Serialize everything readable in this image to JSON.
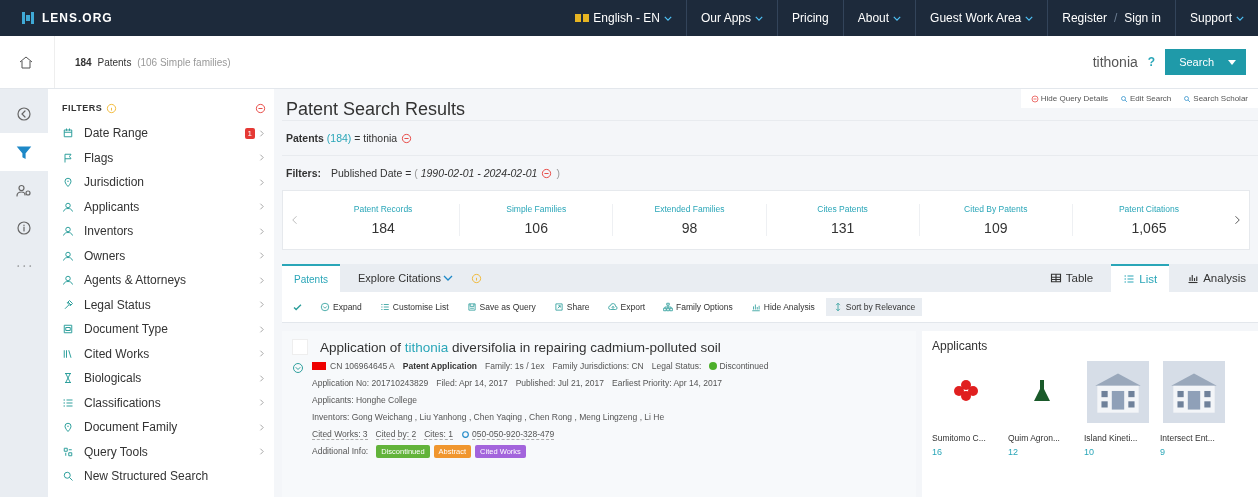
{
  "nav": {
    "logo": "LENS.ORG",
    "language": "English - EN",
    "items": [
      {
        "label": "Our Apps",
        "dropdown": true
      },
      {
        "label": "Pricing",
        "dropdown": false
      },
      {
        "label": "About",
        "dropdown": true
      },
      {
        "label": "Guest Work Area",
        "dropdown": true
      },
      {
        "label": "Register",
        "separator": "/",
        "label2": "Sign in"
      },
      {
        "label": "Support",
        "dropdown": true
      }
    ]
  },
  "search_bar": {
    "count": "184",
    "count_label": "Patents",
    "families": "(106 Simple families)",
    "query": "tithonia",
    "help": "?",
    "button": "Search"
  },
  "rail": [
    {
      "kind": "back",
      "selected": false
    },
    {
      "kind": "filter",
      "selected": true
    },
    {
      "kind": "people",
      "selected": false
    },
    {
      "kind": "info",
      "selected": false
    },
    {
      "kind": "more",
      "selected": false
    }
  ],
  "filters": {
    "title": "FILTERS",
    "items": [
      {
        "label": "Date Range",
        "kind": "calendar",
        "badge": "1",
        "chevron": true
      },
      {
        "label": "Flags",
        "kind": "flag",
        "chevron": true
      },
      {
        "label": "Jurisdiction",
        "kind": "pin",
        "chevron": true
      },
      {
        "label": "Applicants",
        "kind": "person",
        "chevron": true
      },
      {
        "label": "Inventors",
        "kind": "person",
        "chevron": true
      },
      {
        "label": "Owners",
        "kind": "person",
        "chevron": true
      },
      {
        "label": "Agents & Attorneys",
        "kind": "person",
        "chevron": true
      },
      {
        "label": "Legal Status",
        "kind": "gavel",
        "chevron": true
      },
      {
        "label": "Document Type",
        "kind": "doc",
        "chevron": true
      },
      {
        "label": "Cited Works",
        "kind": "books",
        "chevron": true
      },
      {
        "label": "Biologicals",
        "kind": "hourglass",
        "chevron": true
      },
      {
        "label": "Classifications",
        "kind": "list",
        "chevron": true
      },
      {
        "label": "Document Family",
        "kind": "pin",
        "chevron": true
      },
      {
        "label": "Query Tools",
        "kind": "tools",
        "chevron": true
      },
      {
        "label": "New Structured Search",
        "kind": "search",
        "chevron": false
      }
    ]
  },
  "results": {
    "title": "Patent Search Results",
    "links": [
      {
        "kind": "hide",
        "label": "Hide Query Details"
      },
      {
        "kind": "search",
        "label": "Edit Search"
      },
      {
        "kind": "search",
        "label": "Search Scholar"
      }
    ],
    "query": {
      "label": "Patents",
      "count": "(184)",
      "equals": "=",
      "term": "tithonia"
    },
    "filter_line": {
      "label": "Filters:",
      "field": "Published Date =",
      "open": "(",
      "value": "1990-02-01 - 2024-02-01",
      "close": ")"
    },
    "stats": [
      {
        "label": "Patent Records",
        "value": "184",
        "selected": true
      },
      {
        "label": "Simple Families",
        "value": "106",
        "selected": false
      },
      {
        "label": "Extended Families",
        "value": "98",
        "selected": false
      },
      {
        "label": "Cites Patents",
        "value": "131",
        "selected": false
      },
      {
        "label": "Cited By Patents",
        "value": "109",
        "selected": false
      },
      {
        "label": "Patent Citations",
        "value": "1,065",
        "selected": false
      }
    ],
    "tabs": [
      {
        "label": "Patents",
        "selected": true
      },
      {
        "label": "Explore Citations",
        "selected": false
      }
    ],
    "views": [
      {
        "label": "Table",
        "kind": "table",
        "selected": false
      },
      {
        "label": "List",
        "kind": "list",
        "selected": true
      },
      {
        "label": "Analysis",
        "kind": "chart",
        "selected": false
      }
    ],
    "toolbar": [
      {
        "label": "Expand",
        "kind": "expand",
        "highlighted": false
      },
      {
        "label": "Customise List",
        "kind": "list",
        "highlighted": false
      },
      {
        "label": "Save as Query",
        "kind": "save",
        "highlighted": false
      },
      {
        "label": "Share",
        "kind": "share",
        "highlighted": false
      },
      {
        "label": "Export",
        "kind": "cloud",
        "highlighted": false
      },
      {
        "label": "Family Options",
        "kind": "tree",
        "highlighted": false
      },
      {
        "label": "Hide Analysis",
        "kind": "chart",
        "highlighted": false
      },
      {
        "label": "Sort by Relevance",
        "kind": "sort",
        "highlighted": true
      }
    ],
    "result": {
      "title_before": "Application of",
      "title_highlight": "tithonia",
      "title_after": "diversifolia in repairing cadmium-polluted soil",
      "checked": false,
      "number": "CN 106964645 A",
      "type": "Patent Application",
      "family": "Family: 1s / 1ex",
      "jurisdictions": "Family Jurisdictions: CN",
      "status_label": "Legal Status:",
      "status": {
        "label": "Discontinued",
        "color": "#4caf2a"
      },
      "line2": [
        "Application No: 201710243829",
        "Filed: Apr 14, 2017",
        "Published: Jul 21, 2017",
        "Earliest Priority: Apr 14, 2017"
      ],
      "applicants": "Applicants: Honghe College",
      "inventors": "Inventors: Gong Weichang , Liu Yanhong , Chen Yaqing , Chen Rong , Meng Lingzeng , Li He",
      "counts": [
        "Cited Works: 3",
        "Cited by: 2",
        "Cites: 1"
      ],
      "lens_id": "050-050-920-328-479",
      "info_label": "Additional Info:",
      "tags": [
        {
          "label": "Discontinued",
          "color": "#62b33a"
        },
        {
          "label": "Abstract",
          "color": "#f0962e"
        },
        {
          "label": "Cited Works",
          "color": "#a364dc"
        }
      ]
    }
  },
  "applicants": {
    "title": "Applicants",
    "cards": [
      {
        "name": "Sumitomo C...",
        "count": "16",
        "kind": "flower"
      },
      {
        "name": "Quim Agron...",
        "count": "12",
        "kind": "flask"
      },
      {
        "name": "Island Kineti...",
        "count": "10",
        "kind": "building"
      },
      {
        "name": "Intersect Ent...",
        "count": "9",
        "kind": "building"
      }
    ]
  }
}
